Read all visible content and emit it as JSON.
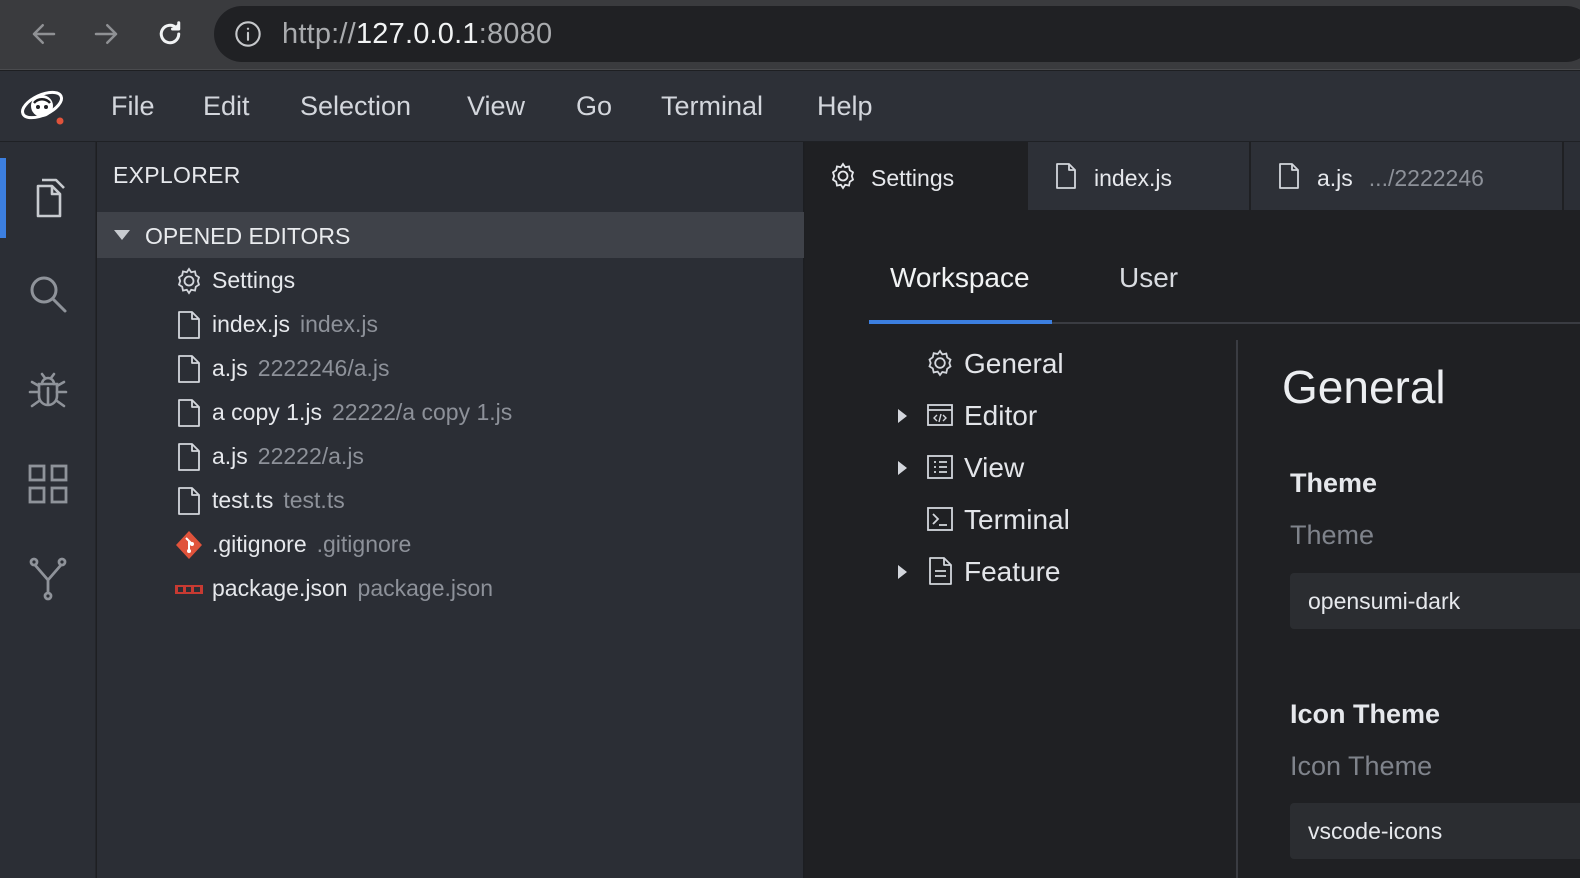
{
  "browser": {
    "url_scheme": "http://",
    "url_host": "127.0.0.1",
    "url_port": ":8080"
  },
  "menubar": {
    "items": [
      "File",
      "Edit",
      "Selection",
      "View",
      "Go",
      "Terminal",
      "Help"
    ]
  },
  "sidebar": {
    "title": "EXPLORER",
    "section": "OPENED EDITORS",
    "files": [
      {
        "name": "Settings",
        "desc": "",
        "icon": "settings-icon"
      },
      {
        "name": "index.js",
        "desc": "index.js",
        "icon": "file-icon"
      },
      {
        "name": "a.js",
        "desc": "2222246/a.js",
        "icon": "file-icon"
      },
      {
        "name": "a copy 1.js",
        "desc": "22222/a copy 1.js",
        "icon": "file-icon"
      },
      {
        "name": "a.js",
        "desc": "22222/a.js",
        "icon": "file-icon"
      },
      {
        "name": "test.ts",
        "desc": "test.ts",
        "icon": "file-icon"
      },
      {
        "name": ".gitignore",
        "desc": ".gitignore",
        "icon": "git-icon"
      },
      {
        "name": "package.json",
        "desc": "package.json",
        "icon": "npm-icon"
      }
    ]
  },
  "tabs": [
    {
      "label": "Settings",
      "desc": "",
      "icon": "settings-icon"
    },
    {
      "label": "index.js",
      "desc": "",
      "icon": "file-icon"
    },
    {
      "label": "a.js",
      "desc": ".../2222246",
      "icon": "file-icon"
    }
  ],
  "settings": {
    "scope_tabs": [
      "Workspace",
      "User"
    ],
    "tree": [
      {
        "label": "General",
        "icon": "gear-icon",
        "expandable": false
      },
      {
        "label": "Editor",
        "icon": "editor-icon",
        "expandable": true
      },
      {
        "label": "View",
        "icon": "list-icon",
        "expandable": true
      },
      {
        "label": "Terminal",
        "icon": "terminal-icon",
        "expandable": false
      },
      {
        "label": "Feature",
        "icon": "document-icon",
        "expandable": true
      }
    ],
    "content_title": "General",
    "fields": [
      {
        "label": "Theme",
        "description": "Theme",
        "value": "opensumi-dark"
      },
      {
        "label": "Icon Theme",
        "description": "Icon Theme",
        "value": "vscode-icons"
      }
    ]
  },
  "colors": {
    "accent": "#3c7fe0",
    "git": "#e0533b",
    "npm": "#c73a32"
  }
}
